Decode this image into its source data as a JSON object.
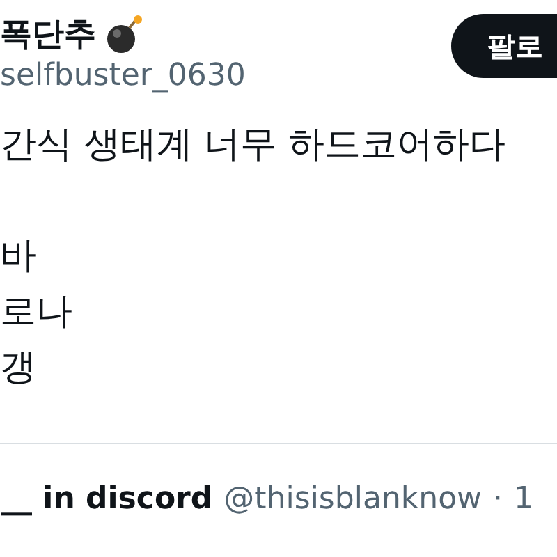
{
  "author": {
    "name": "폭단추",
    "handle": "selfbuster_0630"
  },
  "follow_button": {
    "label": "팔로"
  },
  "tweet_lines": [
    "간식 생태계 너무 하드코어하다",
    "바",
    "로나",
    "갱"
  ],
  "quoted_tweet": {
    "name": "__ in discord",
    "handle": "@thisisblanknow",
    "separator": "·",
    "time": "1"
  }
}
